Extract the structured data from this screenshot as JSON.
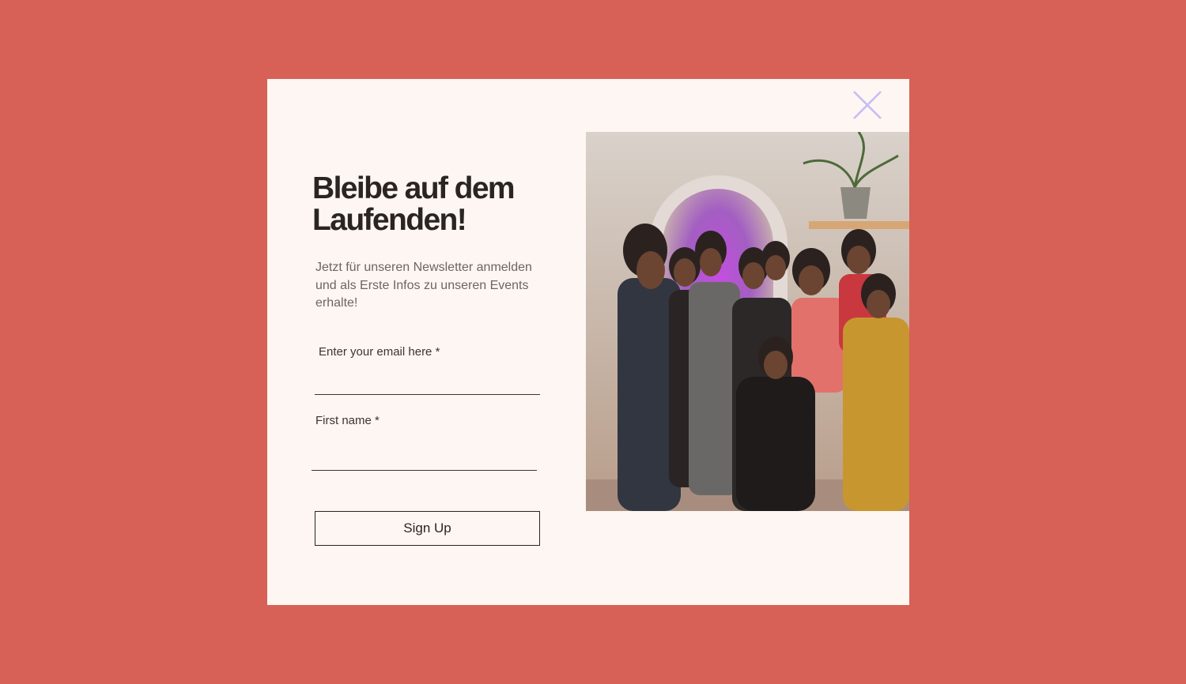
{
  "popup": {
    "heading": "Bleibe auf dem Laufenden!",
    "subtitle": "Jetzt für unseren Newsletter anmelden und als Erste Infos zu unseren Events erhalte!",
    "close_icon": "close-icon",
    "email_field": {
      "label": "Enter your email here *",
      "value": ""
    },
    "first_name_field": {
      "label": "First name *",
      "value": ""
    },
    "signup_button_label": "Sign Up"
  },
  "colors": {
    "page_background": "#d76157",
    "popup_background": "#fdf6f2",
    "close_icon": "#c7bdf2",
    "text_primary": "#2a2422",
    "text_secondary": "#6d6562"
  }
}
